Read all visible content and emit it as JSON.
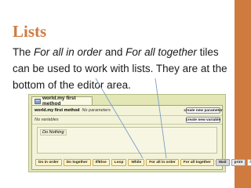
{
  "slide": {
    "title": "Lists",
    "body": {
      "p1": "The ",
      "em1": "For all in order",
      "p2": " and ",
      "em2": "For all together",
      "p3": " tiles can be used to work with lists.  They are at the bottom of the editor area."
    },
    "accent_color": "#cf7b3f"
  },
  "editor": {
    "tab_label": "world.my first method",
    "method_name": "world.my first method",
    "no_params_label": "No parameters",
    "no_vars_label": "No variables",
    "create_param_label": "create new parameter",
    "create_var_label": "create new variable",
    "do_nothing_label": "Do Nothing",
    "tiles": {
      "do_in_order": "Do in order",
      "do_together": "Do together",
      "if_else": "If/Else",
      "loop": "Loop",
      "while": "While",
      "for_all_in_order": "For all in order",
      "for_all_together": "For all together",
      "wait": "Wait",
      "print": "print",
      "slash": "//"
    }
  }
}
